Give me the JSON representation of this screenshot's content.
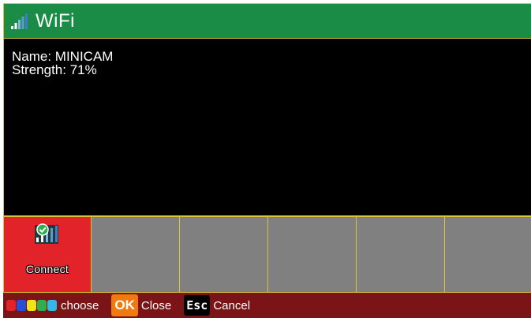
{
  "header": {
    "title": "WiFi",
    "icon": "wifi-signal-icon"
  },
  "info": {
    "name_line": "Name: MINICAM",
    "strength_line": "Strength: 71%"
  },
  "tiles": [
    {
      "label": "Connect",
      "icon": "connect-check-signal-icon",
      "selected": true
    },
    {
      "label": ""
    },
    {
      "label": ""
    },
    {
      "label": ""
    },
    {
      "label": ""
    },
    {
      "label": ""
    }
  ],
  "footer": {
    "color_keys": [
      "#e2242a",
      "#2a4fd6",
      "#f2e21a",
      "#2fae4a",
      "#37b7e6"
    ],
    "choose_label": "choose",
    "ok_key": "OK",
    "ok_label": "Close",
    "esc_key": "Esc",
    "esc_label": "Cancel"
  },
  "colors": {
    "header_bg": "#1a8c46",
    "tile_selected_bg": "#e2242a",
    "tile_bg": "#808080",
    "footer_bg": "#7a1416",
    "border": "#d8c43a"
  }
}
